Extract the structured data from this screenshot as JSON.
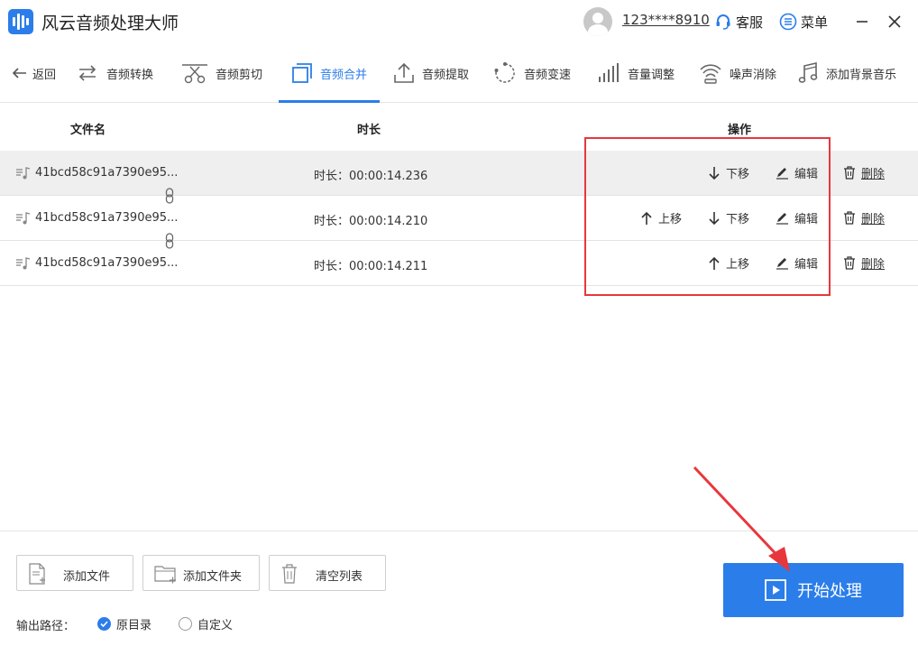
{
  "app": {
    "title": "风云音频处理大师",
    "account": "123****8910",
    "service_label": "客服",
    "menu_label": "菜单"
  },
  "nav": {
    "back_label": "返回",
    "items": [
      {
        "label": "音频转换",
        "icon": "convert-icon"
      },
      {
        "label": "音频剪切",
        "icon": "scissors-icon"
      },
      {
        "label": "音频合并",
        "icon": "merge-icon",
        "active": true
      },
      {
        "label": "音频提取",
        "icon": "extract-icon"
      },
      {
        "label": "音频变速",
        "icon": "speed-icon"
      },
      {
        "label": "音量调整",
        "icon": "volume-bars-icon"
      },
      {
        "label": "噪声消除",
        "icon": "noise-icon"
      },
      {
        "label": "添加背景音乐",
        "icon": "music-note-icon"
      }
    ]
  },
  "table": {
    "headers": {
      "filename": "文件名",
      "duration": "时长",
      "actions": "操作"
    },
    "rows": [
      {
        "filename": "41bcd58c91a7390e95...",
        "duration": "时长：00:00:14.236",
        "selected": true
      },
      {
        "filename": "41bcd58c91a7390e95...",
        "duration": "时长：00:00:14.210",
        "selected": false
      },
      {
        "filename": "41bcd58c91a7390e95...",
        "duration": "时长：00:00:14.211",
        "selected": false
      }
    ],
    "actions": {
      "up": "上移",
      "down": "下移",
      "edit": "编辑",
      "delete": "删除"
    }
  },
  "bottom": {
    "add_file": "添加文件",
    "add_folder": "添加文件夹",
    "clear_list": "清空列表",
    "output_label": "输出路径：",
    "radio_original": "原目录",
    "radio_custom": "自定义",
    "start": "开始处理"
  },
  "colors": {
    "accent": "#2b7de9",
    "highlight": "#e8373c"
  }
}
